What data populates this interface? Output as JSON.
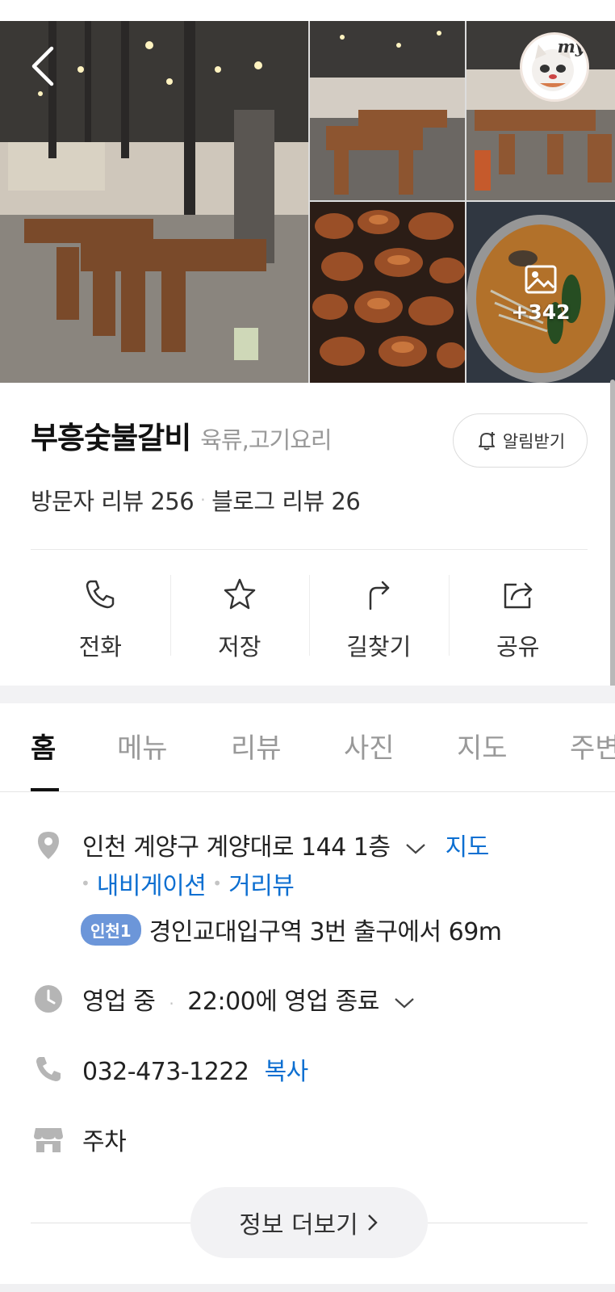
{
  "place": {
    "name": "부흥숯불갈비",
    "category": "육류,고기요리",
    "alarm_label": "알림받기"
  },
  "gallery": {
    "more_count": "+342",
    "my_badge": "my"
  },
  "reviews": {
    "visitor": "방문자 리뷰 256",
    "blog": "블로그 리뷰 26",
    "separator": "·"
  },
  "actions": [
    {
      "label": "전화",
      "icon": "phone-icon"
    },
    {
      "label": "저장",
      "icon": "star-icon"
    },
    {
      "label": "길찾기",
      "icon": "directions-icon"
    },
    {
      "label": "공유",
      "icon": "share-icon"
    }
  ],
  "tabs": [
    {
      "label": "홈",
      "active": true
    },
    {
      "label": "메뉴"
    },
    {
      "label": "리뷰"
    },
    {
      "label": "사진"
    },
    {
      "label": "지도"
    },
    {
      "label": "주변"
    }
  ],
  "info": {
    "address": "인천 계양구 계양대로 144 1층",
    "map_link": "지도",
    "navigation_link": "내비게이션",
    "streetview_link": "거리뷰",
    "subway_line": "인천1",
    "subway_direction": "경인교대입구역 3번 출구에서 69m",
    "hours_status": "영업 중",
    "hours_detail": "22:00에 영업 종료",
    "phone": "032-473-1222",
    "copy_label": "복사",
    "parking": "주차",
    "more_button": "정보 더보기"
  },
  "colors": {
    "link": "#0d6fd1",
    "subway_badge": "#6c96d9",
    "icon_gray": "#b5b5b5"
  }
}
